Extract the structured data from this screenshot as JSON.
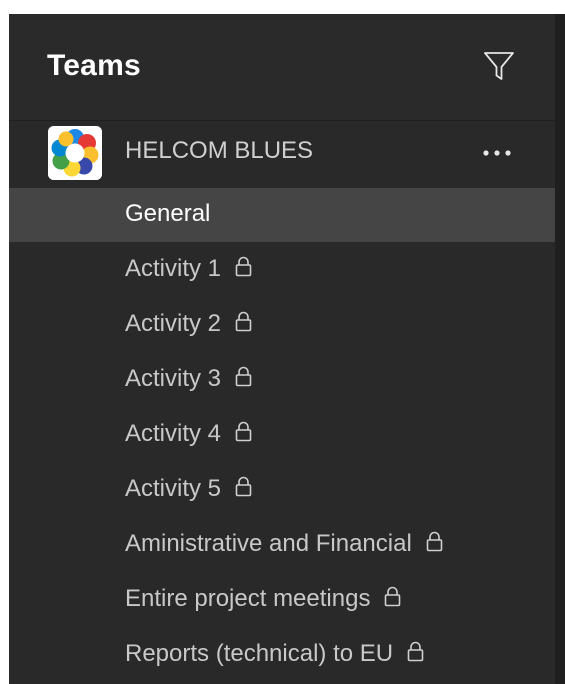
{
  "header": {
    "title": "Teams",
    "filter_icon": "filter-icon"
  },
  "team": {
    "name": "HELCOM BLUES",
    "avatar_icon": "team-logo",
    "more_icon": "more-icon"
  },
  "channels": [
    {
      "label": "General",
      "selected": true,
      "private": false
    },
    {
      "label": "Activity 1",
      "selected": false,
      "private": true
    },
    {
      "label": "Activity 2",
      "selected": false,
      "private": true
    },
    {
      "label": "Activity 3",
      "selected": false,
      "private": true
    },
    {
      "label": "Activity 4",
      "selected": false,
      "private": true
    },
    {
      "label": "Activity 5",
      "selected": false,
      "private": true
    },
    {
      "label": "Aministrative and Financial",
      "selected": false,
      "private": true
    },
    {
      "label": "Entire project meetings",
      "selected": false,
      "private": true
    },
    {
      "label": "Reports (technical) to EU",
      "selected": false,
      "private": true
    }
  ],
  "colors": {
    "panel_bg": "#292929",
    "selected_bg": "#454545",
    "text": "#c8c8c8",
    "text_bright": "#ffffff"
  }
}
